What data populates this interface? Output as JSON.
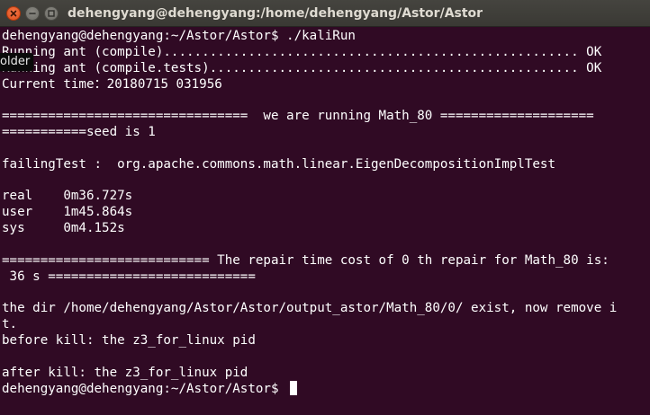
{
  "window": {
    "title": "dehengyang@dehengyang:/home/dehengyang/Astor/Astor"
  },
  "tooltip": {
    "text": "older"
  },
  "terminal": {
    "lines": [
      "dehengyang@dehengyang:~/Astor/Astor$ ./kaliRun",
      "Running ant (compile)...................................................... OK",
      "Running ant (compile.tests)................................................ OK",
      "Current time：20180715 031956",
      "",
      "================================  we are running Math_80 ====================",
      "===========seed is 1",
      "",
      "failingTest :  org.apache.commons.math.linear.EigenDecompositionImplTest",
      "",
      "real    0m36.727s",
      "user    1m45.864s",
      "sys     0m4.152s",
      "",
      "=========================== The repair time cost of 0 th repair for Math_80 is:",
      " 36 s ===========================",
      "",
      "the dir /home/dehengyang/Astor/Astor/output_astor/Math_80/0/ exist, now remove i",
      "t.",
      "before kill: the z3_for_linux pid",
      "",
      "after kill: the z3_for_linux pid"
    ],
    "prompt": "dehengyang@dehengyang:~/Astor/Astor$ "
  },
  "colors": {
    "background": "#300a24",
    "text": "#ffffff",
    "titlebar": "#3c3b37",
    "close_button": "#df4a16"
  },
  "icons": {
    "close": "close-icon",
    "minimize": "minimize-icon",
    "maximize": "maximize-icon"
  }
}
